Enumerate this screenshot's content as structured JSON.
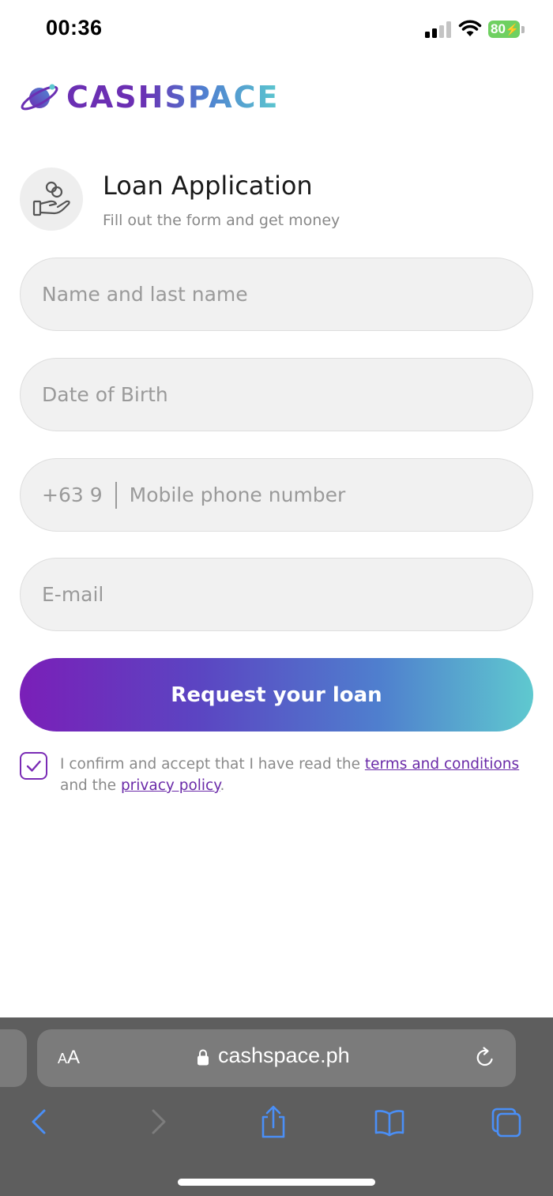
{
  "status_bar": {
    "time": "00:36",
    "battery": "80"
  },
  "brand": {
    "name": "CASHSPACE"
  },
  "header": {
    "title": "Loan Application",
    "subtitle": "Fill out the form and get money"
  },
  "form": {
    "name_placeholder": "Name and last name",
    "dob_placeholder": "Date of Birth",
    "phone_prefix": "+63 9",
    "phone_placeholder": "Mobile phone number",
    "email_placeholder": "E-mail",
    "submit_label": "Request your loan",
    "consent_checked": true,
    "consent_text_1": "I confirm and accept that I have read the ",
    "terms_link": "terms and conditions",
    "consent_text_2": " and the ",
    "privacy_link": "privacy policy",
    "consent_text_3": "."
  },
  "browser": {
    "text_size_label_small": "A",
    "text_size_label_large": "A",
    "url": "cashspace.ph"
  },
  "colors": {
    "brand_purple": "#7a1fb8",
    "brand_teal": "#5fc9cf",
    "link": "#6a2aa8"
  }
}
